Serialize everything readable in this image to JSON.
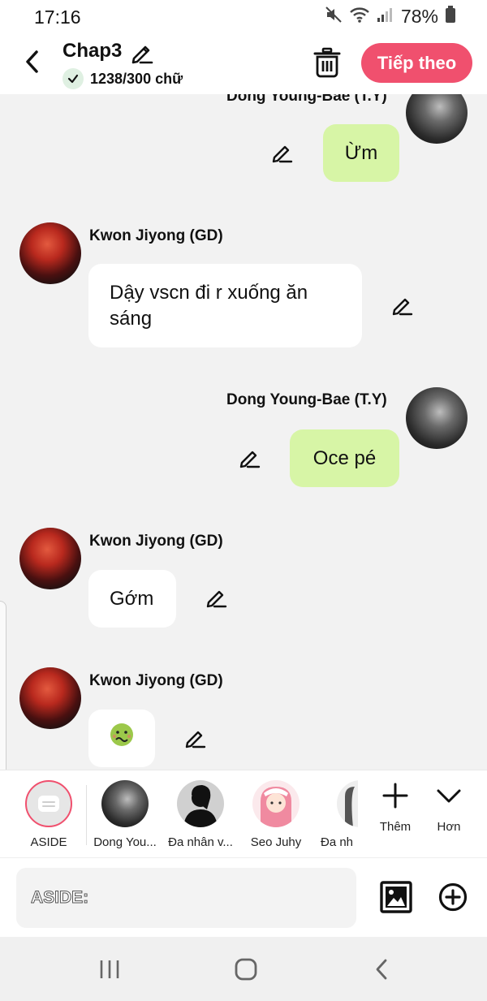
{
  "status_bar": {
    "time": "17:16",
    "battery_percent": "78%"
  },
  "header": {
    "title": "Chap3",
    "word_count": "1238/300 chữ",
    "next_button": "Tiếp theo",
    "accent_color": "#f0506e"
  },
  "messages": [
    {
      "side": "right",
      "sender": "Dong Young-Bae (T.Y)",
      "text": "Ừm"
    },
    {
      "side": "left",
      "sender": "Kwon Jiyong (GD)",
      "text": "Dậy vscn đi r xuống ăn sáng"
    },
    {
      "side": "right",
      "sender": "Dong Young-Bae (T.Y)",
      "text": "Oce pé"
    },
    {
      "side": "left",
      "sender": "Kwon Jiyong (GD)",
      "text": "Gớm"
    },
    {
      "side": "left",
      "sender": "Kwon Jiyong (GD)",
      "text": "🤢"
    }
  ],
  "characters": [
    {
      "label": "ASIDE"
    },
    {
      "label": "Dong You..."
    },
    {
      "label": "Đa nhân v..."
    },
    {
      "label": "Seo Juhy"
    },
    {
      "label": "Đa nh"
    }
  ],
  "strip_actions": {
    "add_label": "Thêm",
    "more_label": "Hơn"
  },
  "input": {
    "placeholder": "ASIDE:"
  },
  "colors": {
    "right_bubble": "#d7f5a6",
    "left_bubble": "#ffffff"
  }
}
